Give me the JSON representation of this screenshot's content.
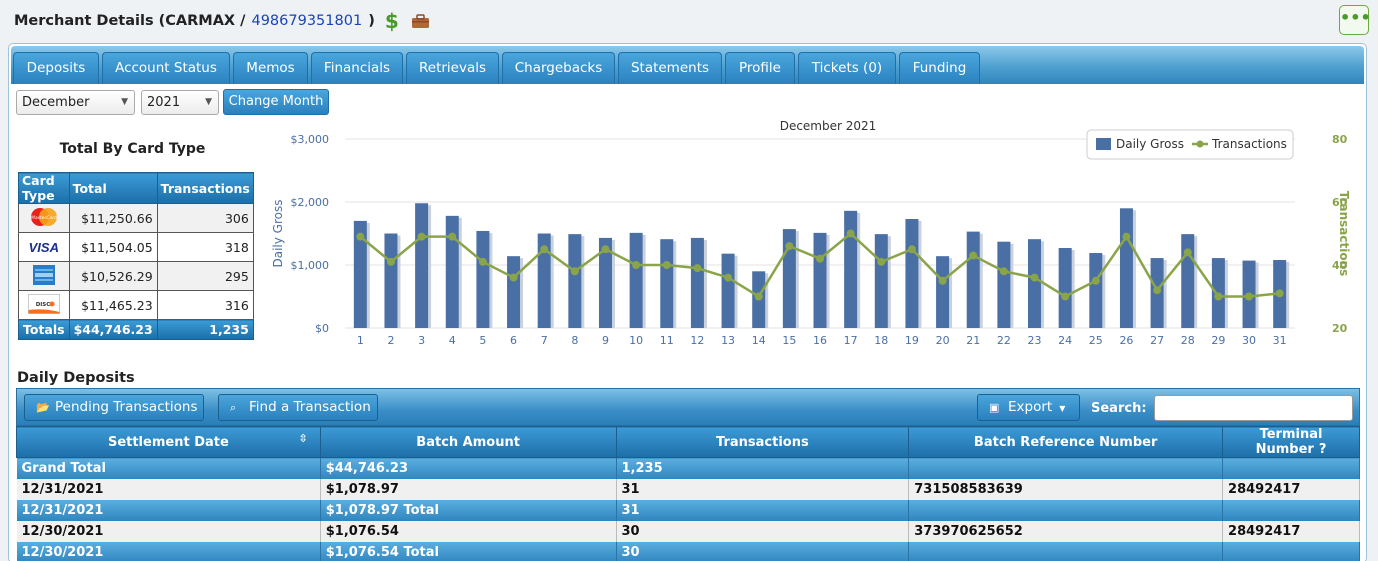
{
  "header": {
    "title_prefix": "Merchant Details (CARMAX /",
    "merchant_id": "498679351801",
    "title_suffix": ")",
    "more_label": "•••"
  },
  "tabs": [
    {
      "label": "Deposits",
      "active": true
    },
    {
      "label": "Account Status"
    },
    {
      "label": "Memos"
    },
    {
      "label": "Financials"
    },
    {
      "label": "Retrievals"
    },
    {
      "label": "Chargebacks"
    },
    {
      "label": "Statements"
    },
    {
      "label": "Profile"
    },
    {
      "label": "Tickets (0)"
    },
    {
      "label": "Funding"
    }
  ],
  "filters": {
    "month": "December",
    "year": "2021",
    "change_label": "Change Month"
  },
  "card_summary": {
    "title": "Total By Card Type",
    "headers": [
      "Card Type",
      "Total",
      "Transactions"
    ],
    "rows": [
      {
        "card": "MasterCard",
        "total": "$11,250.66",
        "transactions": "306"
      },
      {
        "card": "VISA",
        "total": "$11,504.05",
        "transactions": "318"
      },
      {
        "card": "AMEX",
        "total": "$10,526.29",
        "transactions": "295"
      },
      {
        "card": "DISCOVER",
        "total": "$11,465.23",
        "transactions": "316"
      }
    ],
    "totals": {
      "label": "Totals",
      "total": "$44,746.23",
      "transactions": "1,235"
    }
  },
  "chart_data": {
    "type": "bar",
    "title": "December 2021",
    "categories": [
      "1",
      "2",
      "3",
      "4",
      "5",
      "6",
      "7",
      "8",
      "9",
      "10",
      "11",
      "12",
      "13",
      "14",
      "15",
      "16",
      "17",
      "18",
      "19",
      "20",
      "21",
      "22",
      "23",
      "24",
      "25",
      "26",
      "27",
      "28",
      "29",
      "30",
      "31"
    ],
    "series": [
      {
        "name": "Daily Gross",
        "type": "bar",
        "axis": "left",
        "color": "#4a6fa5",
        "values": [
          1700,
          1500,
          1980,
          1780,
          1540,
          1140,
          1500,
          1490,
          1430,
          1510,
          1410,
          1430,
          1180,
          900,
          1570,
          1510,
          1860,
          1490,
          1730,
          1140,
          1530,
          1370,
          1410,
          1270,
          1190,
          1900,
          1110,
          1490,
          1110,
          1070,
          1078.97
        ]
      },
      {
        "name": "Transactions",
        "type": "line",
        "axis": "right",
        "color": "#8aa44a",
        "values": [
          49,
          41,
          49,
          49,
          41,
          36,
          45,
          38,
          45,
          40,
          40,
          39,
          36,
          30,
          46,
          42,
          50,
          41,
          45,
          35,
          43,
          38,
          36,
          30,
          35,
          49,
          32,
          44,
          30,
          30,
          31
        ]
      }
    ],
    "ylabel": "Daily Gross",
    "y2label": "Transactions",
    "ylim": [
      0,
      3000
    ],
    "y_ticks": [
      "$0",
      "$1,000",
      "$2,000",
      "$3,000"
    ],
    "y2lim": [
      20,
      80
    ],
    "y2_ticks": [
      "20",
      "40",
      "60",
      "80"
    ],
    "legend": "top-right",
    "grid": true
  },
  "daily": {
    "title": "Daily Deposits",
    "pending_label": "Pending Transactions",
    "find_label": "Find a Transaction",
    "export_label": "Export",
    "search_label": "Search:",
    "search_value": "",
    "columns": [
      "Settlement Date",
      "Batch Amount",
      "Transactions",
      "Batch Reference Number",
      "Terminal Number"
    ],
    "help": "?",
    "rows": [
      {
        "style": "blue",
        "cells": [
          "Grand Total",
          "$44,746.23",
          "1,235",
          "",
          ""
        ]
      },
      {
        "style": "grey",
        "cells": [
          "12/31/2021",
          "$1,078.97",
          "31",
          "731508583639",
          "28492417"
        ]
      },
      {
        "style": "blue",
        "cells": [
          "12/31/2021",
          "$1,078.97 Total",
          "31",
          "",
          ""
        ]
      },
      {
        "style": "grey",
        "cells": [
          "12/30/2021",
          "$1,076.54",
          "30",
          "373970625652",
          "28492417"
        ]
      },
      {
        "style": "blue",
        "cells": [
          "12/30/2021",
          "$1,076.54 Total",
          "30",
          "",
          ""
        ]
      }
    ]
  },
  "colors": {
    "accent": "#2b81bf",
    "active_tab": "#6aab36",
    "bar": "#4a6fa5",
    "line": "#8aa44a"
  }
}
